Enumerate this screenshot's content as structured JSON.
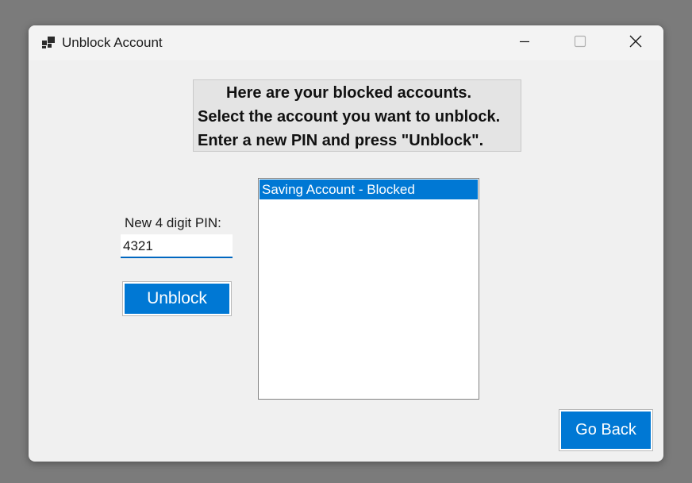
{
  "window": {
    "title": "Unblock Account",
    "icon": "app-window-icon"
  },
  "caption_buttons": {
    "minimize_icon": "minimize-icon",
    "maximize_icon": "maximize-icon",
    "close_icon": "close-icon"
  },
  "instructions": {
    "line1": "Here are your blocked accounts.",
    "line2": "Select the account you want to unblock.",
    "line3": "Enter a new PIN and press \"Unblock\"."
  },
  "pin": {
    "label": "New 4 digit PIN:",
    "value": "4321"
  },
  "buttons": {
    "unblock_label": "Unblock",
    "go_back_label": "Go Back"
  },
  "accounts": {
    "items": [
      {
        "label": "Saving Account - Blocked",
        "selected": true
      }
    ]
  },
  "colors": {
    "accent": "#0078d4",
    "window_bg": "#f0f0f0",
    "desktop_bg": "#7b7b7b"
  }
}
